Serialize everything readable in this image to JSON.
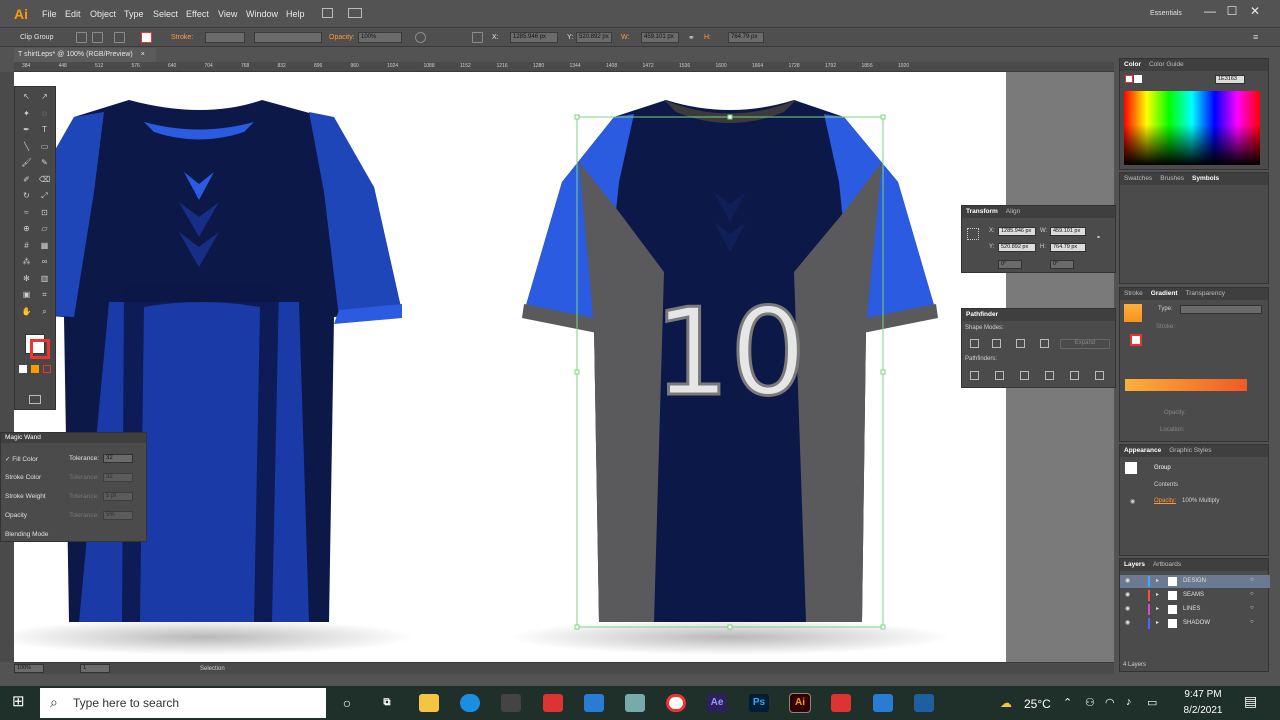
{
  "app": {
    "logo": "Ai",
    "workspace": "Essentials",
    "window_controls": [
      "—",
      "☐",
      "✕"
    ]
  },
  "menu": [
    "File",
    "Edit",
    "Object",
    "Type",
    "Select",
    "Effect",
    "View",
    "Window",
    "Help"
  ],
  "control_bar": {
    "selection": "Clip Group",
    "stroke_label": "Stroke:",
    "opacity_label": "Opacity:",
    "opacity_value": "100%",
    "x_label": "X:",
    "x_value": "1285.946 px",
    "y_label": "Y:",
    "y_value": "520.892 px",
    "w_label": "W:",
    "w_value": "459.101 px",
    "h_label": "H:",
    "h_value": "764.79 px"
  },
  "document_tab": {
    "title": "T shirtLeps* @ 100% (RGB/Preview)",
    "close": "×"
  },
  "ruler_ticks": [
    "384",
    "448",
    "512",
    "576",
    "640",
    "704",
    "768",
    "832",
    "896",
    "960",
    "1024",
    "1088",
    "1152",
    "1216",
    "1280",
    "1344",
    "1408",
    "1472",
    "1536",
    "1600",
    "1664",
    "1728",
    "1792",
    "1856",
    "1920"
  ],
  "artwork": {
    "jersey_number": "10",
    "colors": {
      "navy": "#0c1848",
      "blue": "#1f46b8",
      "bright_blue": "#2a5be0",
      "gray": "#5a5a5c",
      "dark_gray": "#3b3b3d",
      "selection": "#7ed37e"
    }
  },
  "magic_wand": {
    "title": "Magic Wand",
    "rows": [
      {
        "label": "Fill Color",
        "sub": "Tolerance:",
        "value": "32",
        "checked": true
      },
      {
        "label": "Stroke Color",
        "sub": "Tolerance:",
        "value": "32",
        "checked": false
      },
      {
        "label": "Stroke Weight",
        "sub": "Tolerance:",
        "value": "5 pt",
        "checked": false
      },
      {
        "label": "Opacity",
        "sub": "Tolerance:",
        "value": "5%",
        "checked": false
      },
      {
        "label": "Blending Mode",
        "sub": "",
        "value": "",
        "checked": false
      }
    ]
  },
  "transform_panel": {
    "tabs": [
      "Transform",
      "Align"
    ],
    "x_label": "X:",
    "x": "1285.946 px",
    "y_label": "Y:",
    "y": "520.892 px",
    "w_label": "W:",
    "w": "459.101 px",
    "h_label": "H:",
    "h": "764.79 px",
    "rotate": "0°",
    "shear": "0°"
  },
  "pathfinder_panel": {
    "title": "Pathfinder",
    "shape_modes": "Shape Modes:",
    "expand": "Expand",
    "pathfinders": "Pathfinders:"
  },
  "color_panel": {
    "tabs": [
      "Color",
      "Color Guide"
    ],
    "hex": "1E3163"
  },
  "swatches_panel": {
    "tabs": [
      "Swatches",
      "Brushes",
      "Symbols"
    ]
  },
  "gradient_panel": {
    "tabs": [
      "Stroke",
      "Gradient",
      "Transparency"
    ],
    "type_label": "Type:",
    "stroke_label": "Stroke:",
    "angle_label": "",
    "opacity_label": "Opacity:",
    "location_label": "Location:"
  },
  "appearance_panel": {
    "tabs": [
      "Appearance",
      "Graphic Styles"
    ],
    "group": "Group",
    "contents": "Contents",
    "opacity": "Opacity:",
    "opacity_value": "100% Multiply"
  },
  "layers_panel": {
    "tabs": [
      "Layers",
      "Artboards"
    ],
    "layers": [
      {
        "name": "DESIGN",
        "color": "#4aa3ff"
      },
      {
        "name": "SEAMS",
        "color": "#ff4a4a"
      },
      {
        "name": "LINES",
        "color": "#d24ad2"
      },
      {
        "name": "SHADOW",
        "color": "#4a6aff"
      }
    ],
    "count": "4 Layers"
  },
  "status_bar": {
    "zoom": "100%",
    "artboard": "1",
    "tool": "Selection"
  },
  "taskbar": {
    "search_placeholder": "Type here to search",
    "weather": "25°C",
    "time": "9:47 PM",
    "date": "8/2/2021",
    "apps": [
      "Ae",
      "Ps",
      "Ai"
    ]
  }
}
